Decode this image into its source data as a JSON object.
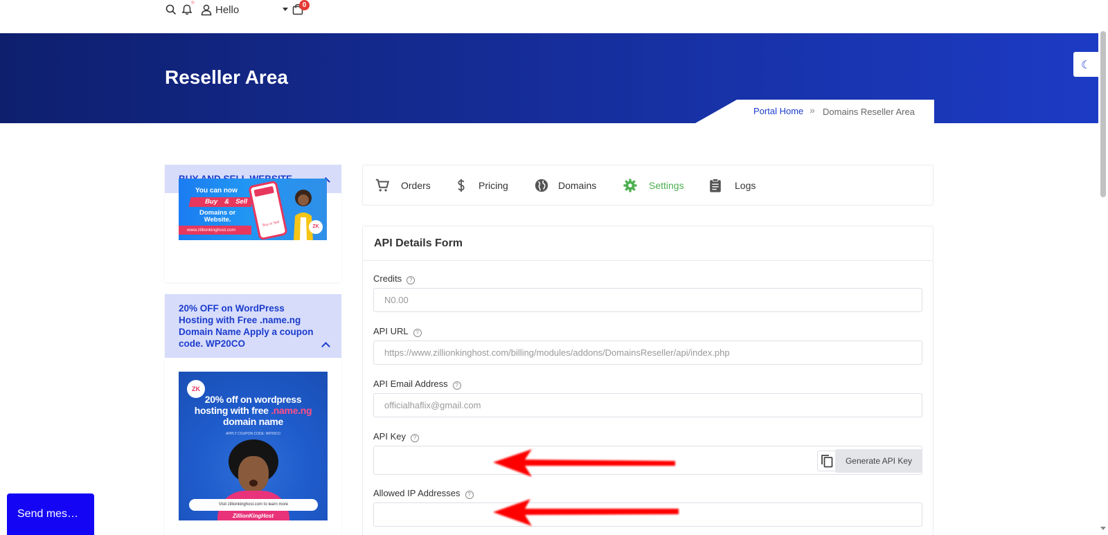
{
  "topbar": {
    "greeting": "Hello",
    "cart_count": "0",
    "icons": [
      "search-icon",
      "bell-icon",
      "user-icon",
      "cart-icon"
    ]
  },
  "hero": {
    "title": "Reseller Area",
    "breadcrumb": {
      "home": "Portal Home",
      "separator": "»",
      "current": "Domains Reseller Area"
    }
  },
  "sidebar": {
    "cards": [
      {
        "heading": "BUY AND SELL WEBSITE",
        "promo": {
          "line1": "You can now",
          "buy": "Buy",
          "amp": "&",
          "sell": "Sell",
          "line2": "Domains or",
          "line3": "Website.",
          "url": "www.zillionkinghost.com",
          "logo": "ZK",
          "phone_button": "Buy or Sell"
        }
      },
      {
        "heading": "20% OFF on WordPress Hosting with Free .name.ng Domain Name Apply a coupon code. WP20CO",
        "promo": {
          "logo": "ZK",
          "title_a": "20% off on wordpress",
          "title_b": "hosting with free",
          "title_pink": ".name.ng",
          "title_c": "domain name",
          "coupon": "APPLY COUPON CODE: WP20CO",
          "cta": "Visit zillionkinghost.com to learn more",
          "brand": "ZillionKingHost"
        }
      }
    ]
  },
  "tabs": [
    {
      "label": "Orders",
      "icon": "cart-icon",
      "active": false
    },
    {
      "label": "Pricing",
      "icon": "dollar-icon",
      "active": false
    },
    {
      "label": "Domains",
      "icon": "globe-icon",
      "active": false
    },
    {
      "label": "Settings",
      "icon": "gear-icon",
      "active": true
    },
    {
      "label": "Logs",
      "icon": "clipboard-icon",
      "active": false
    }
  ],
  "form": {
    "title": "API Details Form",
    "help_glyph": "?",
    "fields": {
      "credits": {
        "label": "Credits",
        "placeholder": "N0.00"
      },
      "api_url": {
        "label": "API URL",
        "placeholder": "https://www.zillionkinghost.com/billing/modules/addons/DomainsReseller/api/index.php"
      },
      "api_email": {
        "label": "API Email Address",
        "placeholder": "officialhaflix@gmail.com"
      },
      "api_key": {
        "label": "API Key",
        "value": "",
        "generate_label": "Generate API Key"
      },
      "allowed_ips": {
        "label": "Allowed IP Addresses",
        "value": ""
      }
    }
  },
  "chat": {
    "label": "Send mes…"
  },
  "colors": {
    "hero_dark": "#0e1f6e",
    "hero_light": "#1c3bc4",
    "accent_blue": "#1a3bcc",
    "active_green": "#4caf50",
    "sidebar_head_bg": "#d7dcfb",
    "chat_bg": "#1406f5",
    "annotation_arrow": "#ff0000"
  }
}
